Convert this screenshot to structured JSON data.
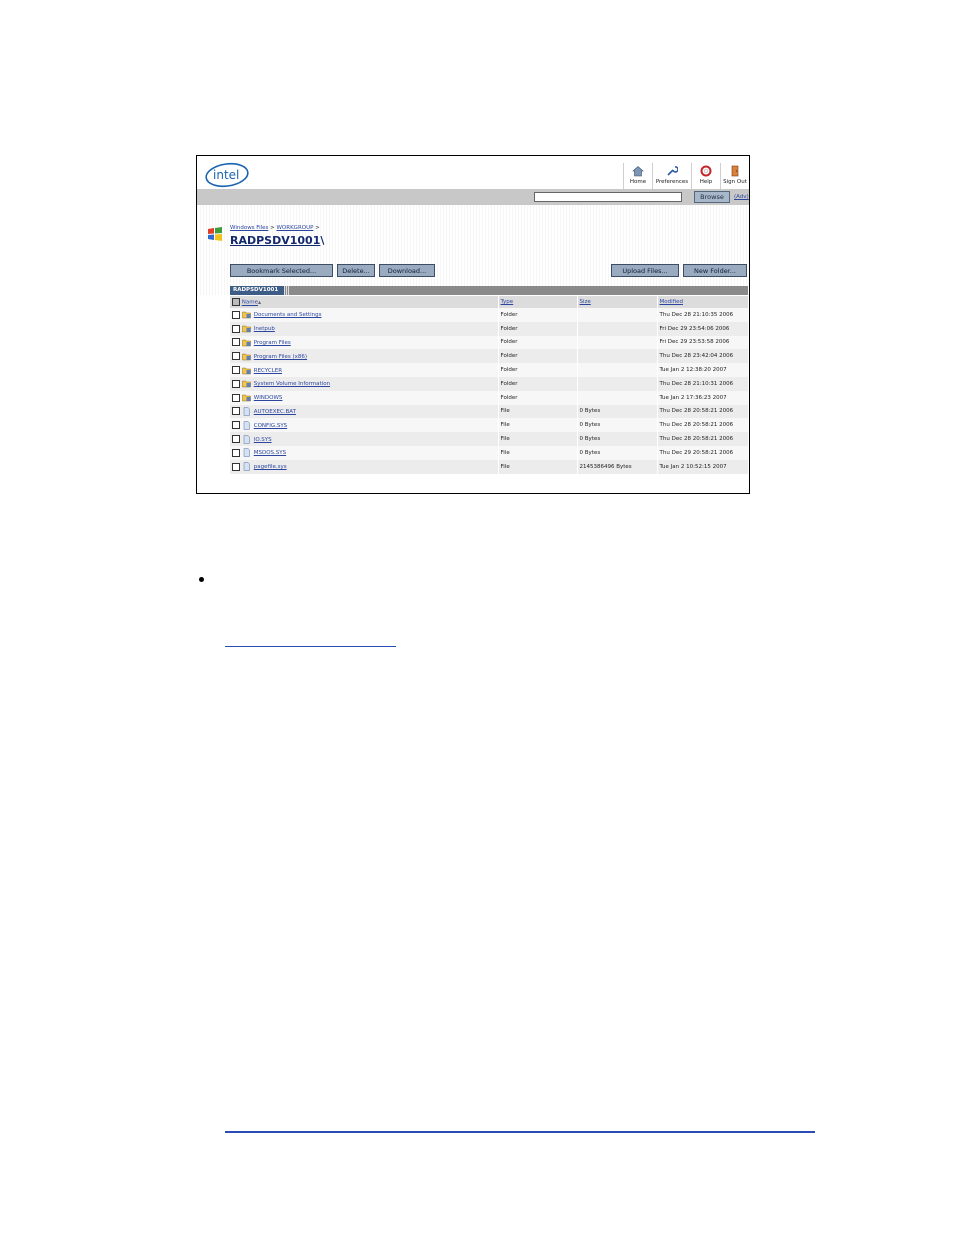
{
  "header": {
    "logo_text": "intel",
    "toolbar": [
      {
        "label": "Home",
        "icon": "home-icon"
      },
      {
        "label": "Preferences",
        "icon": "wrench-icon"
      },
      {
        "label": "Help",
        "icon": "lifebuoy-icon"
      },
      {
        "label": "Sign Out",
        "icon": "door-icon"
      }
    ]
  },
  "search": {
    "value": "",
    "browse_label": "Browse",
    "adv_label": "(Adv)"
  },
  "breadcrumb": {
    "root": "Windows Files",
    "sep1": " > ",
    "group": "WORKGROUP",
    "sep2": " >"
  },
  "title": {
    "server": "RADPSDV1001",
    "suffix": "\\"
  },
  "actions": {
    "bookmark": "Bookmark Selected...",
    "delete": "Delete...",
    "download": "Download...",
    "upload": "Upload Files...",
    "new_folder": "New Folder..."
  },
  "tab": {
    "label": "RADPSDV1001"
  },
  "table": {
    "headers": {
      "name": "Name",
      "sort_marker": "▲",
      "type": "Type",
      "size": "Size",
      "modified": "Modified"
    },
    "rows": [
      {
        "name": "Documents and Settings",
        "type": "Folder",
        "size": "",
        "modified": "Thu Dec 28 21:10:35 2006",
        "icon": "folder-icon"
      },
      {
        "name": "Inetpub",
        "type": "Folder",
        "size": "",
        "modified": "Fri Dec 29 23:54:06 2006",
        "icon": "folder-icon"
      },
      {
        "name": "Program Files",
        "type": "Folder",
        "size": "",
        "modified": "Fri Dec 29 23:53:58 2006",
        "icon": "folder-icon"
      },
      {
        "name": "Program Files (x86)",
        "type": "Folder",
        "size": "",
        "modified": "Thu Dec 28 23:42:04 2006",
        "icon": "folder-icon"
      },
      {
        "name": "RECYCLER",
        "type": "Folder",
        "size": "",
        "modified": "Tue Jan 2 12:38:20 2007",
        "icon": "folder-icon"
      },
      {
        "name": "System Volume Information",
        "type": "Folder",
        "size": "",
        "modified": "Thu Dec 28 21:10:31 2006",
        "icon": "folder-icon"
      },
      {
        "name": "WINDOWS",
        "type": "Folder",
        "size": "",
        "modified": "Tue Jan 2 17:36:23 2007",
        "icon": "folder-icon"
      },
      {
        "name": "AUTOEXEC.BAT",
        "type": "File",
        "size": "0 Bytes",
        "modified": "Thu Dec 28 20:58:21 2006",
        "icon": "file-icon"
      },
      {
        "name": "CONFIG.SYS",
        "type": "File",
        "size": "0 Bytes",
        "modified": "Thu Dec 28 20:58:21 2006",
        "icon": "file-icon"
      },
      {
        "name": "IO.SYS",
        "type": "File",
        "size": "0 Bytes",
        "modified": "Thu Dec 28 20:58:21 2006",
        "icon": "file-icon"
      },
      {
        "name": "MSDOS.SYS",
        "type": "File",
        "size": "0 Bytes",
        "modified": "Thu Dec 29 20:58:21 2006",
        "icon": "file-icon"
      },
      {
        "name": "pagefile.sys",
        "type": "File",
        "size": "2145386496 Bytes",
        "modified": "Tue Jan 2 10:52:15 2007",
        "icon": "file-icon"
      }
    ]
  },
  "colors": {
    "link": "#2c46a0",
    "title": "#14286e",
    "tab": "#3d5d86",
    "rule": "#2a4db3"
  }
}
